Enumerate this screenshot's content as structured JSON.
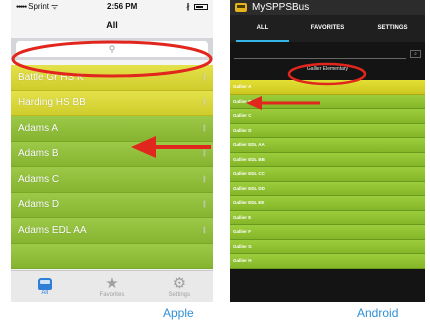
{
  "apple": {
    "status": {
      "carrier": "Sprint",
      "signal": "●●●●●",
      "wifi": "ᯤ",
      "time": "2:56 PM",
      "bluetooth": "∦"
    },
    "nav_title": "All",
    "search_icon": "⚲",
    "routes": [
      {
        "label": "Battle Gr HS K",
        "color": "#d7d43a"
      },
      {
        "label": "Harding HS BB",
        "color": "#d7d43a"
      },
      {
        "label": "Adams A",
        "color": "#8dbb38"
      },
      {
        "label": "Adams B",
        "color": "#8dbb38"
      },
      {
        "label": "Adams C",
        "color": "#8dbb38"
      },
      {
        "label": "Adams D",
        "color": "#8dbb38"
      },
      {
        "label": "Adams EDL AA",
        "color": "#8dbb38"
      },
      {
        "label": "",
        "color": "#8dbb38"
      }
    ],
    "row_grip": "|||",
    "tabs": [
      {
        "label": "All",
        "icon": "bus-icon",
        "active": true
      },
      {
        "label": "Favorites",
        "icon": "star-icon",
        "glyph": "★",
        "active": false
      },
      {
        "label": "Settings",
        "icon": "gear-icon",
        "glyph": "⚙",
        "active": false
      }
    ],
    "caption": "Apple"
  },
  "android": {
    "app_title": "MySPPSBus",
    "tabs": [
      {
        "label": "ALL",
        "active": true
      },
      {
        "label": "FAVORITES",
        "active": false
      },
      {
        "label": "SETTINGS",
        "active": false
      }
    ],
    "search_button": "⌕",
    "search_query": "Gallier Elementary",
    "routes": [
      {
        "label": "Gallier A",
        "color": "#d7d43a"
      },
      {
        "label": "Gallier B",
        "color": "#8dbb38"
      },
      {
        "label": "Gallier C",
        "color": "#8dbb38"
      },
      {
        "label": "Gallier D",
        "color": "#8dbb38"
      },
      {
        "label": "Gallier EDL AA",
        "color": "#8dbb38"
      },
      {
        "label": "Gallier EDL BB",
        "color": "#8dbb38"
      },
      {
        "label": "Gallier EDL CC",
        "color": "#8dbb38"
      },
      {
        "label": "Gallier EDL DD",
        "color": "#8dbb38"
      },
      {
        "label": "Gallier EDL EE",
        "color": "#8dbb38"
      },
      {
        "label": "Gallier E",
        "color": "#8dbb38"
      },
      {
        "label": "Gallier F",
        "color": "#8dbb38"
      },
      {
        "label": "Gallier G",
        "color": "#8dbb38"
      },
      {
        "label": "Gallier H",
        "color": "#8dbb38"
      }
    ],
    "caption": "Android"
  },
  "annotations": {
    "color": "#e0261d"
  }
}
